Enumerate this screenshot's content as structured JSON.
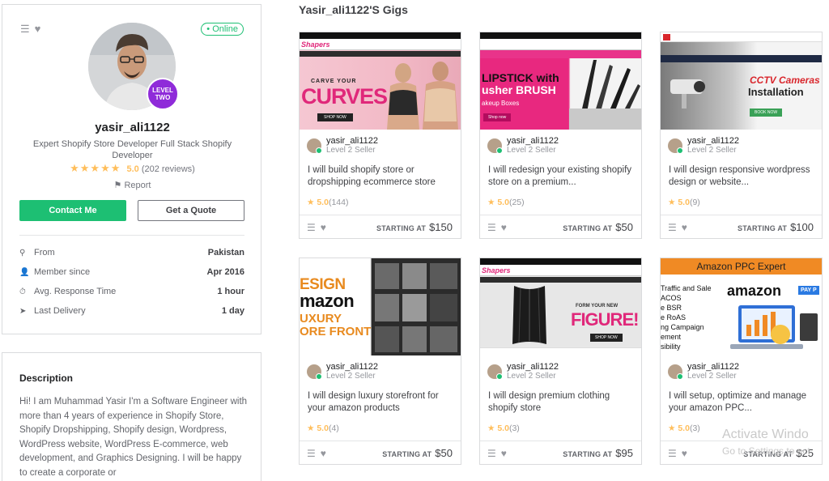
{
  "profile": {
    "online_label": "• Online",
    "level_line1": "LEVEL",
    "level_line2": "TWO",
    "username": "yasir_ali1122",
    "tagline": "Expert Shopify Store Developer Full Stack Shopify Developer",
    "stars": "★★★★★",
    "rating": "5.0",
    "reviews": "(202 reviews)",
    "report_label": "Report",
    "contact_label": "Contact Me",
    "quote_label": "Get a Quote",
    "stats": [
      {
        "icon": "location-pin-icon",
        "glyph": "⚲",
        "label": "From",
        "value": "Pakistan"
      },
      {
        "icon": "user-icon",
        "glyph": "👤",
        "label": "Member since",
        "value": "Apr 2016"
      },
      {
        "icon": "clock-icon",
        "glyph": "⏱",
        "label": "Avg. Response Time",
        "value": "1 hour"
      },
      {
        "icon": "paper-plane-icon",
        "glyph": "➤",
        "label": "Last Delivery",
        "value": "1 day"
      }
    ]
  },
  "description": {
    "title": "Description",
    "text": "Hi! I am Muhammad Yasir I'm a Software Engineer with more than 4 years of experience in Shopify Store, Shopify Dropshipping, Shopify design, Wordpress, WordPress website, WordPress E-commerce, web development, and Graphics Designing. I will be happy to create a corporate or"
  },
  "gigs_title": "Yasir_ali1122'S Gigs",
  "starting_at": "STARTING AT",
  "gigs": [
    {
      "seller": "yasir_ali1122",
      "level": "Level 2 Seller",
      "title": "I will build shopify store or dropshipping ecommerce store",
      "rating": "5.0",
      "count": "(144)",
      "price": "$150"
    },
    {
      "seller": "yasir_ali1122",
      "level": "Level 2 Seller",
      "title": "I will redesign your existing shopify store on a premium...",
      "rating": "5.0",
      "count": "(25)",
      "price": "$50"
    },
    {
      "seller": "yasir_ali1122",
      "level": "Level 2 Seller",
      "title": "I will design responsive wordpress design or website...",
      "rating": "5.0",
      "count": "(9)",
      "price": "$100"
    },
    {
      "seller": "yasir_ali1122",
      "level": "Level 2 Seller",
      "title": "I will design luxury storefront for your amazon products",
      "rating": "5.0",
      "count": "(4)",
      "price": "$50"
    },
    {
      "seller": "yasir_ali1122",
      "level": "Level 2 Seller",
      "title": "I will design premium clothing shopify store",
      "rating": "5.0",
      "count": "(3)",
      "price": "$95"
    },
    {
      "seller": "yasir_ali1122",
      "level": "Level 2 Seller",
      "title": "I will setup, optimize and manage your amazon PPC...",
      "rating": "5.0",
      "count": "(3)",
      "price": "$25"
    }
  ],
  "thumbs": {
    "t1_logo": "Shapers",
    "t1_l1": "CARVE YOUR",
    "t1_l2": "CURVES",
    "t1_cta": "SHOP NOW",
    "t2_l1": "LIPSTICK with",
    "t2_l2": "usher BRUSH",
    "t2_l3": "akeup Boxes",
    "t2_cta": "Shop now",
    "t3_l1": "CCTV Cameras",
    "t3_l2": "Installation",
    "t3_cta": "BOOK NOW",
    "t4_l1": "ESIGN",
    "t4_l2": "mazon",
    "t4_l3": "UXURY",
    "t4_l4": "ORE FRONT",
    "t5_logo": "Shapers",
    "t5_l1": "FORM YOUR NEW",
    "t5_l2": "FIGURE!",
    "t5_cta": "SHOP NOW",
    "t6_head": "Amazon PPC Expert",
    "t6_list": [
      "Traffic and Sale",
      "ACOS",
      "e BSR",
      "e RoAS",
      "ng Campaign",
      "ement",
      "sibility"
    ],
    "t6_amazon": "amazon",
    "t6_pay": "PAY P"
  },
  "watermark": {
    "line1": "Activate Windo",
    "line2": "Go to Settings to act"
  },
  "colors": {
    "brand_green": "#1dbf73",
    "star_gold": "#ffbe5b",
    "level_purple": "#8f2bd9",
    "pink_accent": "#e0287a"
  }
}
